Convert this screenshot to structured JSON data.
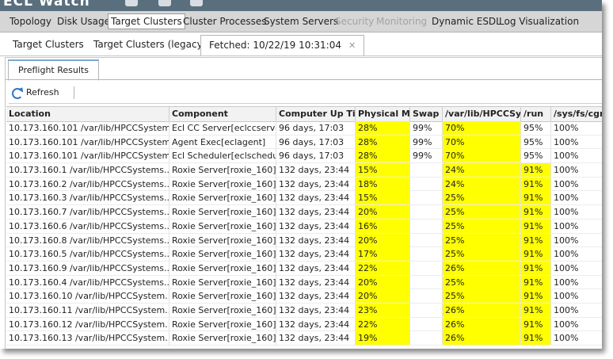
{
  "app": {
    "title": "ECL Watch"
  },
  "nav": {
    "items": [
      {
        "label": "Topology",
        "state": "normal"
      },
      {
        "label": "Disk Usage",
        "state": "normal"
      },
      {
        "label": "Target Clusters",
        "state": "active"
      },
      {
        "label": "Cluster Processes",
        "state": "normal"
      },
      {
        "label": "System Servers",
        "state": "normal"
      },
      {
        "label": "Security",
        "state": "disabled"
      },
      {
        "label": "Monitoring",
        "state": "disabled"
      },
      {
        "label": "Dynamic ESDL",
        "state": "normal"
      },
      {
        "label": "Log Visualization",
        "state": "normal"
      }
    ]
  },
  "subtabs": {
    "items": [
      {
        "label": "Target Clusters"
      },
      {
        "label": "Target Clusters (legacy)"
      },
      {
        "label": "Fetched: 10/22/19 10:31:04"
      }
    ],
    "close_glyph": "✕"
  },
  "panel": {
    "tab_label": "Preflight Results",
    "refresh_label": "Refresh"
  },
  "grid": {
    "columns": [
      "Location",
      "Component",
      "Computer Up Time",
      "Physical Memory",
      "Swap",
      "/var/lib/HPCCSystems",
      "/run",
      "/sys/fs/cgroup"
    ],
    "highlight_color": "#ffff00",
    "rows": [
      {
        "location": "10.173.160.101 /var/lib/HPCCSystems...",
        "component": "Ecl CC Server[eclccserver]",
        "uptime": "96 days, 17:03",
        "physmem": "28%",
        "swap": "99%",
        "varlib": "70%",
        "run": "95%",
        "cgroup": "100%",
        "hl": [
          true,
          false,
          true,
          false
        ]
      },
      {
        "location": "10.173.160.101 /var/lib/HPCCSystems...",
        "component": "Agent Exec[eclagent]",
        "uptime": "96 days, 17:03",
        "physmem": "28%",
        "swap": "99%",
        "varlib": "70%",
        "run": "95%",
        "cgroup": "100%",
        "hl": [
          true,
          false,
          true,
          false
        ]
      },
      {
        "location": "10.173.160.101 /var/lib/HPCCSystems...",
        "component": "Ecl Scheduler[eclscheduler]",
        "uptime": "96 days, 17:03",
        "physmem": "28%",
        "swap": "99%",
        "varlib": "70%",
        "run": "95%",
        "cgroup": "100%",
        "hl": [
          true,
          false,
          true,
          false
        ]
      },
      {
        "location": "10.173.160.1 /var/lib/HPCCSystems...",
        "component": "Roxie Server[roxie_160]",
        "uptime": "132 days, 23:44",
        "physmem": "15%",
        "swap": "",
        "varlib": "24%",
        "run": "91%",
        "cgroup": "100%",
        "hl": [
          true,
          false,
          true,
          true
        ]
      },
      {
        "location": "10.173.160.2 /var/lib/HPCCSystems...",
        "component": "Roxie Server[roxie_160]",
        "uptime": "132 days, 23:44",
        "physmem": "18%",
        "swap": "",
        "varlib": "24%",
        "run": "91%",
        "cgroup": "100%",
        "hl": [
          true,
          false,
          true,
          true
        ]
      },
      {
        "location": "10.173.160.3 /var/lib/HPCCSystems...",
        "component": "Roxie Server[roxie_160]",
        "uptime": "132 days, 23:44",
        "physmem": "15%",
        "swap": "",
        "varlib": "25%",
        "run": "91%",
        "cgroup": "100%",
        "hl": [
          true,
          false,
          true,
          true
        ]
      },
      {
        "location": "10.173.160.7 /var/lib/HPCCSystems...",
        "component": "Roxie Server[roxie_160]",
        "uptime": "132 days, 23:44",
        "physmem": "20%",
        "swap": "",
        "varlib": "25%",
        "run": "91%",
        "cgroup": "100%",
        "hl": [
          true,
          false,
          true,
          true
        ]
      },
      {
        "location": "10.173.160.6 /var/lib/HPCCSystems...",
        "component": "Roxie Server[roxie_160]",
        "uptime": "132 days, 23:44",
        "physmem": "16%",
        "swap": "",
        "varlib": "25%",
        "run": "91%",
        "cgroup": "100%",
        "hl": [
          true,
          false,
          true,
          true
        ]
      },
      {
        "location": "10.173.160.8 /var/lib/HPCCSystems...",
        "component": "Roxie Server[roxie_160]",
        "uptime": "132 days, 23:44",
        "physmem": "20%",
        "swap": "",
        "varlib": "25%",
        "run": "91%",
        "cgroup": "100%",
        "hl": [
          true,
          false,
          true,
          true
        ]
      },
      {
        "location": "10.173.160.5 /var/lib/HPCCSystems...",
        "component": "Roxie Server[roxie_160]",
        "uptime": "132 days, 23:44",
        "physmem": "17%",
        "swap": "",
        "varlib": "25%",
        "run": "91%",
        "cgroup": "100%",
        "hl": [
          true,
          false,
          true,
          true
        ]
      },
      {
        "location": "10.173.160.9 /var/lib/HPCCSystems...",
        "component": "Roxie Server[roxie_160]",
        "uptime": "132 days, 23:44",
        "physmem": "22%",
        "swap": "",
        "varlib": "26%",
        "run": "91%",
        "cgroup": "100%",
        "hl": [
          true,
          false,
          true,
          true
        ]
      },
      {
        "location": "10.173.160.4 /var/lib/HPCCSystems...",
        "component": "Roxie Server[roxie_160]",
        "uptime": "132 days, 23:44",
        "physmem": "20%",
        "swap": "",
        "varlib": "25%",
        "run": "91%",
        "cgroup": "100%",
        "hl": [
          true,
          false,
          true,
          true
        ]
      },
      {
        "location": "10.173.160.10 /var/lib/HPCCSystem...",
        "component": "Roxie Server[roxie_160]",
        "uptime": "132 days, 23:44",
        "physmem": "20%",
        "swap": "",
        "varlib": "25%",
        "run": "91%",
        "cgroup": "100%",
        "hl": [
          true,
          false,
          true,
          true
        ]
      },
      {
        "location": "10.173.160.11 /var/lib/HPCCSystem...",
        "component": "Roxie Server[roxie_160]",
        "uptime": "132 days, 23:44",
        "physmem": "23%",
        "swap": "",
        "varlib": "26%",
        "run": "91%",
        "cgroup": "100%",
        "hl": [
          true,
          false,
          true,
          true
        ]
      },
      {
        "location": "10.173.160.12 /var/lib/HPCCSystem...",
        "component": "Roxie Server[roxie_160]",
        "uptime": "132 days, 23:44",
        "physmem": "22%",
        "swap": "",
        "varlib": "26%",
        "run": "91%",
        "cgroup": "100%",
        "hl": [
          true,
          false,
          true,
          true
        ]
      },
      {
        "location": "10.173.160.13 /var/lib/HPCCSystem...",
        "component": "Roxie Server[roxie_160]",
        "uptime": "132 days, 23:44",
        "physmem": "19%",
        "swap": "",
        "varlib": "26%",
        "run": "91%",
        "cgroup": "100%",
        "hl": [
          true,
          false,
          true,
          true
        ]
      }
    ]
  }
}
